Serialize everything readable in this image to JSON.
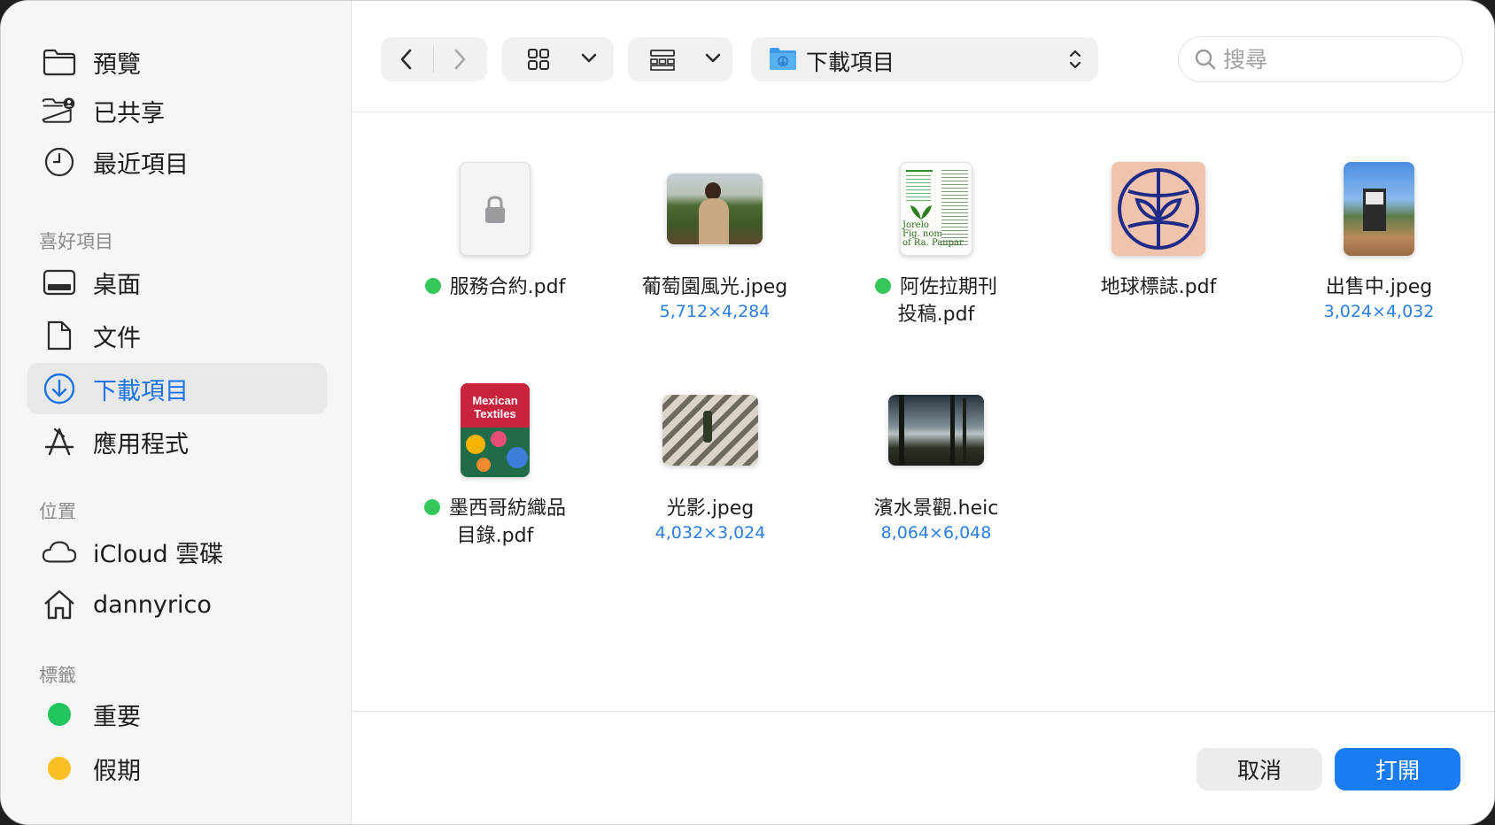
{
  "sidebar": {
    "items": [
      {
        "label": "預覽",
        "icon": "folder-icon"
      },
      {
        "label": "已共享",
        "icon": "shared-folder-icon"
      },
      {
        "label": "最近項目",
        "icon": "clock-icon"
      }
    ],
    "favorites_header": "喜好項目",
    "favorites": [
      {
        "label": "桌面",
        "icon": "desktop-icon"
      },
      {
        "label": "文件",
        "icon": "document-icon"
      },
      {
        "label": "下載項目",
        "icon": "download-icon",
        "active": true
      },
      {
        "label": "應用程式",
        "icon": "apps-icon"
      }
    ],
    "locations_header": "位置",
    "locations": [
      {
        "label": "iCloud 雲碟",
        "icon": "cloud-icon"
      },
      {
        "label": "dannyrico",
        "icon": "home-icon"
      }
    ],
    "tags_header": "標籤",
    "tags": [
      {
        "label": "重要",
        "color": "#22c55e"
      },
      {
        "label": "假期",
        "color": "#fbbf24"
      }
    ]
  },
  "toolbar": {
    "path": "下載項目",
    "search_placeholder": "搜尋"
  },
  "files": [
    {
      "name": "服務合約.pdf",
      "dims": "",
      "tag": true
    },
    {
      "name": "葡萄園風光.jpeg",
      "dims": "5,712×4,284",
      "tag": false
    },
    {
      "name": "阿佐拉期刊\n投稿.pdf",
      "dims": "",
      "tag": true
    },
    {
      "name": "地球標誌.pdf",
      "dims": "",
      "tag": false
    },
    {
      "name": "出售中.jpeg",
      "dims": "3,024×4,032",
      "tag": false
    },
    {
      "name": "墨西哥紡織品\n目錄.pdf",
      "dims": "",
      "tag": true
    },
    {
      "name": "光影.jpeg",
      "dims": "4,032×3,024",
      "tag": false
    },
    {
      "name": "濱水景觀.heic",
      "dims": "8,064×6,048",
      "tag": false
    }
  ],
  "thumb_text": {
    "journal": "Jorelo\nFig. nom\nof Ra. Paupar",
    "textiles": "Mexican\nTextiles"
  },
  "footer": {
    "cancel": "取消",
    "open": "打開"
  },
  "colors": {
    "accent": "#1a7cf5",
    "tag_green": "#34c759"
  }
}
